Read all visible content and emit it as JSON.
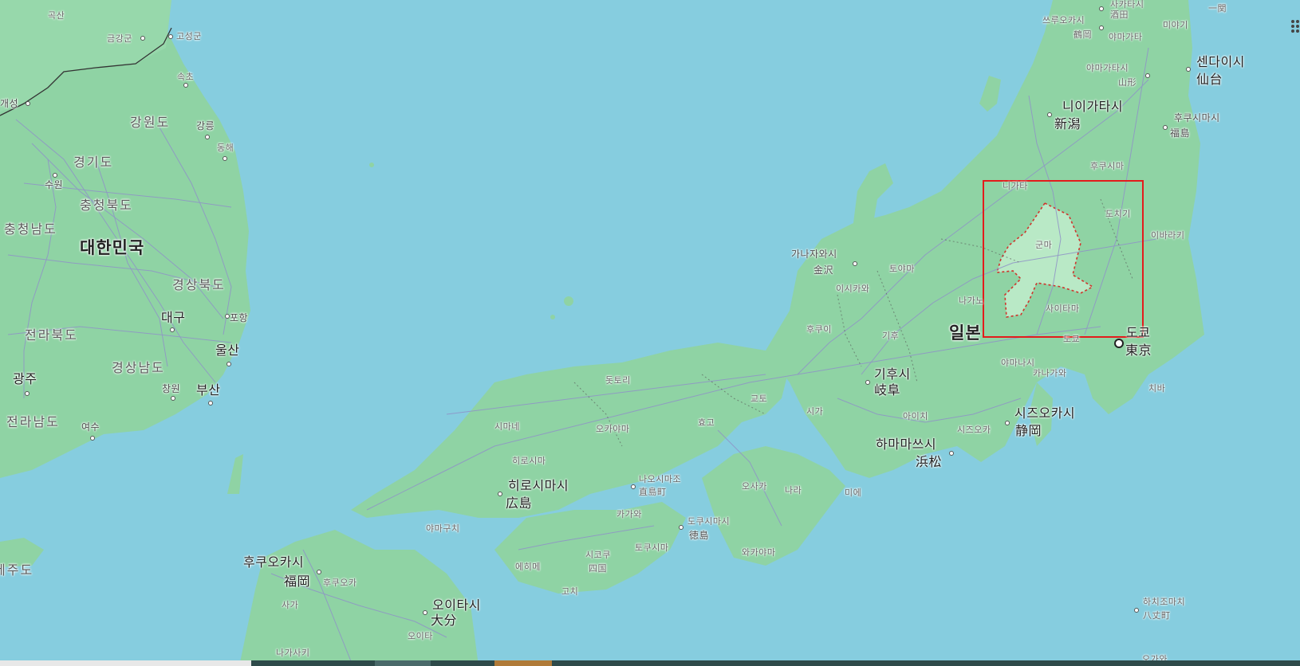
{
  "map": {
    "country_labels": [
      {
        "id": "korea",
        "text": "대한민국"
      },
      {
        "id": "japan",
        "text": "일본"
      }
    ],
    "region_labels": [
      {
        "id": "gangwon",
        "text": "강원도"
      },
      {
        "id": "gyeonggi",
        "text": "경기도"
      },
      {
        "id": "chungbuk",
        "text": "충청북도"
      },
      {
        "id": "chungnam",
        "text": "충청남도"
      },
      {
        "id": "gyeongbuk",
        "text": "경상북도"
      },
      {
        "id": "jeonbuk",
        "text": "전라북도"
      },
      {
        "id": "gyeongnam",
        "text": "경상남도"
      },
      {
        "id": "jeonnam",
        "text": "전라남도"
      },
      {
        "id": "jeju",
        "text": "제주도"
      }
    ],
    "city_labels": [
      {
        "id": "goksan",
        "text": "곡산"
      },
      {
        "id": "geumgang",
        "text": "금강군"
      },
      {
        "id": "goseong",
        "text": "고성군"
      },
      {
        "id": "sokcho",
        "text": "속초"
      },
      {
        "id": "kaesong",
        "text": "개성"
      },
      {
        "id": "gangneung",
        "text": "강릉"
      },
      {
        "id": "donghae",
        "text": "동해"
      },
      {
        "id": "suwon",
        "text": "수원"
      },
      {
        "id": "daegu",
        "text": "대구"
      },
      {
        "id": "pohang",
        "text": "포항"
      },
      {
        "id": "ulsan",
        "text": "울산"
      },
      {
        "id": "changwon",
        "text": "창원"
      },
      {
        "id": "busan",
        "text": "부산"
      },
      {
        "id": "gwangju",
        "text": "광주"
      },
      {
        "id": "yeosu",
        "text": "여수"
      },
      {
        "id": "tsuruoka-ko",
        "text": "쓰루오카시"
      },
      {
        "id": "sakata",
        "text": "酒田"
      },
      {
        "id": "sakata-ko",
        "text": "사카타시"
      },
      {
        "id": "tsuruoka",
        "text": "鶴岡"
      },
      {
        "id": "yamagata-ko",
        "text": "야마가타"
      },
      {
        "id": "miyagi",
        "text": "미야기"
      },
      {
        "id": "ichinoseki",
        "text": "一関"
      },
      {
        "id": "sendai-ko",
        "text": "센다이시"
      },
      {
        "id": "sendai",
        "text": "仙台"
      },
      {
        "id": "yamagatashi-ko",
        "text": "야마가타시"
      },
      {
        "id": "yamagatashi",
        "text": "山形"
      },
      {
        "id": "niigata-ko",
        "text": "니이가타시"
      },
      {
        "id": "niigata",
        "text": "新潟"
      },
      {
        "id": "fukushima-ko",
        "text": "후쿠시마시"
      },
      {
        "id": "fukushima",
        "text": "福島"
      },
      {
        "id": "fukushima-pref",
        "text": "후쿠시마"
      },
      {
        "id": "niigata-pref",
        "text": "니가타"
      },
      {
        "id": "tochigi",
        "text": "도치기"
      },
      {
        "id": "gunma",
        "text": "군마"
      },
      {
        "id": "ibaraki",
        "text": "이바라키"
      },
      {
        "id": "nagano",
        "text": "나가노"
      },
      {
        "id": "saitama",
        "text": "사이타마"
      },
      {
        "id": "tokyo-ko",
        "text": "도쿄"
      },
      {
        "id": "tokyo",
        "text": "東京"
      },
      {
        "id": "tokyo-pref",
        "text": "도쿄"
      },
      {
        "id": "chiba",
        "text": "치바"
      },
      {
        "id": "yamanashi",
        "text": "야마나시"
      },
      {
        "id": "kanagawa",
        "text": "카나가와"
      },
      {
        "id": "kanazawa-ko",
        "text": "가나자와시"
      },
      {
        "id": "kanazawa",
        "text": "金沢"
      },
      {
        "id": "toyama",
        "text": "토야마"
      },
      {
        "id": "ishikawa",
        "text": "이시카와"
      },
      {
        "id": "fukui",
        "text": "후쿠이"
      },
      {
        "id": "gifu-pref",
        "text": "기후"
      },
      {
        "id": "gifu-ko",
        "text": "기후시"
      },
      {
        "id": "gifu",
        "text": "岐阜"
      },
      {
        "id": "aichi",
        "text": "아이치"
      },
      {
        "id": "shiga",
        "text": "시가"
      },
      {
        "id": "kyoto",
        "text": "교토"
      },
      {
        "id": "shizuoka-ko",
        "text": "시즈오카시"
      },
      {
        "id": "shizuoka",
        "text": "静岡"
      },
      {
        "id": "shizuoka-pref",
        "text": "시즈오카"
      },
      {
        "id": "hamamatsu-ko",
        "text": "하마마쓰시"
      },
      {
        "id": "hamamatsu",
        "text": "浜松"
      },
      {
        "id": "tottori",
        "text": "돗토리"
      },
      {
        "id": "shimane",
        "text": "시마네"
      },
      {
        "id": "okayama",
        "text": "오카야마"
      },
      {
        "id": "hyogo",
        "text": "효고"
      },
      {
        "id": "hiroshima-pref",
        "text": "히로시마"
      },
      {
        "id": "hiroshima-ko",
        "text": "히로시마시"
      },
      {
        "id": "hiroshima",
        "text": "広島"
      },
      {
        "id": "naoshima-ko",
        "text": "나오시마조"
      },
      {
        "id": "naoshima",
        "text": "直島町"
      },
      {
        "id": "osaka",
        "text": "오사카"
      },
      {
        "id": "nara",
        "text": "나라"
      },
      {
        "id": "mie",
        "text": "미에"
      },
      {
        "id": "kagawa",
        "text": "카가와"
      },
      {
        "id": "tokushima-ko",
        "text": "도쿠시마시"
      },
      {
        "id": "tokushima",
        "text": "徳島"
      },
      {
        "id": "yamaguchi",
        "text": "야마구치"
      },
      {
        "id": "shikoku-ko",
        "text": "시코쿠"
      },
      {
        "id": "shikoku",
        "text": "四国"
      },
      {
        "id": "tokushima-pref",
        "text": "토쿠시마"
      },
      {
        "id": "ehime",
        "text": "에히메"
      },
      {
        "id": "wakayama",
        "text": "와카야마"
      },
      {
        "id": "kochi",
        "text": "고치"
      },
      {
        "id": "fukuoka-ko",
        "text": "후쿠오카시"
      },
      {
        "id": "fukuoka",
        "text": "福岡"
      },
      {
        "id": "fukuoka-pref",
        "text": "후쿠오카"
      },
      {
        "id": "oita-ko",
        "text": "오이타시"
      },
      {
        "id": "oita",
        "text": "大分"
      },
      {
        "id": "oita-pref",
        "text": "오이타"
      },
      {
        "id": "saga",
        "text": "사가"
      },
      {
        "id": "nagasaki",
        "text": "나가사키"
      },
      {
        "id": "hachijo-ko",
        "text": "하치조마치"
      },
      {
        "id": "hachijo",
        "text": "八丈町"
      },
      {
        "id": "ogasawara",
        "text": "오가와"
      }
    ],
    "selection": {
      "label": "",
      "color": "#e31c1c"
    },
    "colors": {
      "sea": "#86cddf",
      "land": "#8fd3a4",
      "highlight": "#b9e9c6",
      "border": "#d0342c",
      "roads": "#8f93c7"
    }
  }
}
